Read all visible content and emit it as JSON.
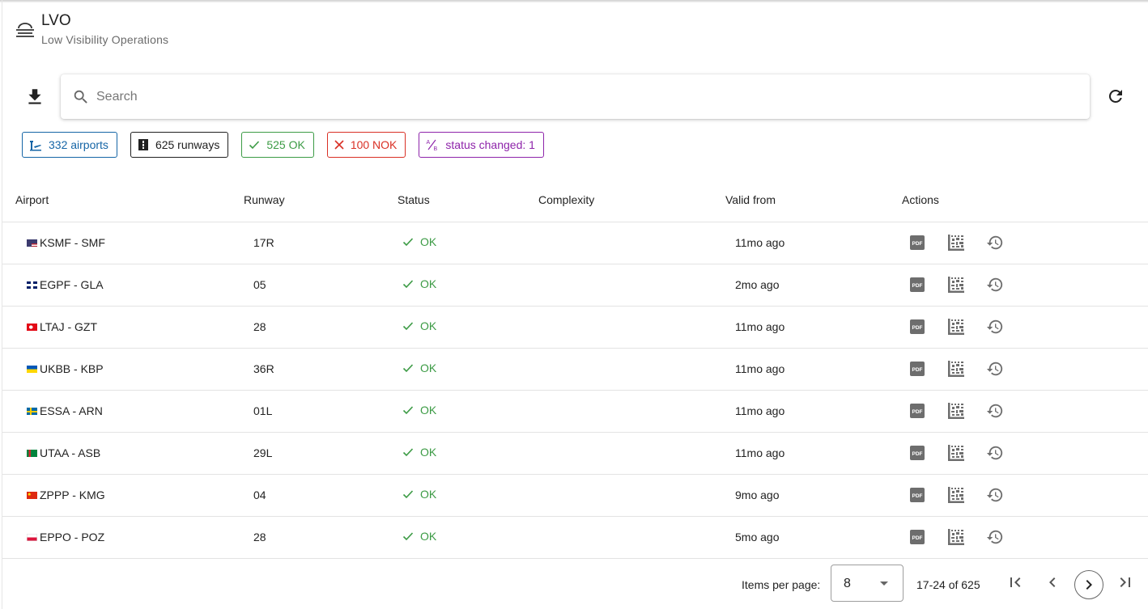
{
  "header": {
    "title": "LVO",
    "subtitle": "Low Visibility Operations"
  },
  "search": {
    "placeholder": "Search",
    "value": ""
  },
  "chips": {
    "airports": "332 airports",
    "runways": "625 runways",
    "ok": "525 OK",
    "nok": "100 NOK",
    "changed": "status changed: 1"
  },
  "colors": {
    "ok": "#3c9b45",
    "nok": "#d93025",
    "airports": "#1565a6",
    "changed": "#8e24aa"
  },
  "table": {
    "columns": [
      "Airport",
      "Runway",
      "Status",
      "Complexity",
      "Valid from",
      "Actions"
    ],
    "rows": [
      {
        "flag": "us",
        "airport": "KSMF - SMF",
        "runway": "17R",
        "status": "OK",
        "complexity": "",
        "valid_from": "11mo ago"
      },
      {
        "flag": "gb",
        "airport": "EGPF - GLA",
        "runway": "05",
        "status": "OK",
        "complexity": "",
        "valid_from": "2mo ago"
      },
      {
        "flag": "tr",
        "airport": "LTAJ - GZT",
        "runway": "28",
        "status": "OK",
        "complexity": "",
        "valid_from": "11mo ago"
      },
      {
        "flag": "ua",
        "airport": "UKBB - KBP",
        "runway": "36R",
        "status": "OK",
        "complexity": "",
        "valid_from": "11mo ago"
      },
      {
        "flag": "se",
        "airport": "ESSA - ARN",
        "runway": "01L",
        "status": "OK",
        "complexity": "",
        "valid_from": "11mo ago"
      },
      {
        "flag": "tm",
        "airport": "UTAA - ASB",
        "runway": "29L",
        "status": "OK",
        "complexity": "",
        "valid_from": "11mo ago"
      },
      {
        "flag": "cn",
        "airport": "ZPPP - KMG",
        "runway": "04",
        "status": "OK",
        "complexity": "",
        "valid_from": "9mo ago"
      },
      {
        "flag": "pl",
        "airport": "EPPO - POZ",
        "runway": "28",
        "status": "OK",
        "complexity": "",
        "valid_from": "5mo ago"
      }
    ],
    "action_icons": [
      "pdf-icon",
      "data-matrix-icon",
      "history-icon"
    ]
  },
  "pagination": {
    "items_per_page_label": "Items per page:",
    "items_per_page": "8",
    "range": "17-24 of 625"
  }
}
